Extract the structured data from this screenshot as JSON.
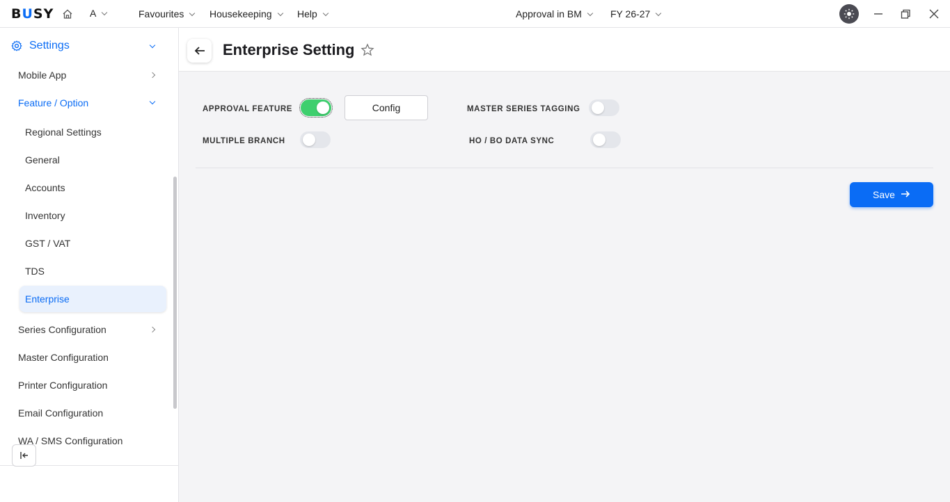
{
  "app": {
    "logo": "BUSY",
    "company": "A",
    "menus": [
      "Favourites",
      "Housekeeping",
      "Help"
    ],
    "company_name": "Approval in BM",
    "financial_year": "FY 26-27"
  },
  "sidebar": {
    "header": "Settings",
    "items": [
      {
        "label": "Mobile App"
      },
      {
        "label": "Feature / Option"
      },
      {
        "label": "Regional Settings"
      },
      {
        "label": "General"
      },
      {
        "label": "Accounts"
      },
      {
        "label": "Inventory"
      },
      {
        "label": "GST / VAT"
      },
      {
        "label": "TDS"
      },
      {
        "label": "Enterprise"
      },
      {
        "label": "Series Configuration"
      },
      {
        "label": "Master Configuration"
      },
      {
        "label": "Printer Configuration"
      },
      {
        "label": "Email Configuration"
      },
      {
        "label": "WA / SMS Configuration"
      }
    ]
  },
  "page": {
    "title": "Enterprise Setting",
    "settings": [
      {
        "label": "APPROVAL FEATURE",
        "enabled": true
      },
      {
        "label": "MULTIPLE BRANCH",
        "enabled": false
      },
      {
        "label": "MASTER SERIES TAGGING",
        "enabled": false
      },
      {
        "label": "HO / BO DATA SYNC",
        "enabled": false
      }
    ],
    "config_label": "Config",
    "save_label": "Save"
  },
  "colors": {
    "accent": "#0a6cf5",
    "toggle_on": "#3ecf6e",
    "toggle_off": "#e4e6eb",
    "active_item_bg": "#e9f1fd"
  }
}
